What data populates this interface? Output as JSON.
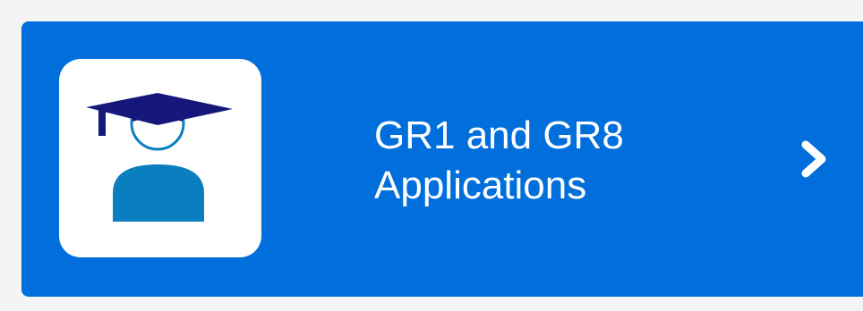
{
  "tile": {
    "title_line1": "GR1 and GR8",
    "title_line2": "Applications",
    "icon": "graduate-icon",
    "action_icon": "chevron-right-icon"
  },
  "colors": {
    "tile_background": "#006fdb",
    "icon_background": "#ffffff",
    "cap_color": "#15187a",
    "person_color": "#0a7fc0",
    "text_color": "#ffffff"
  }
}
